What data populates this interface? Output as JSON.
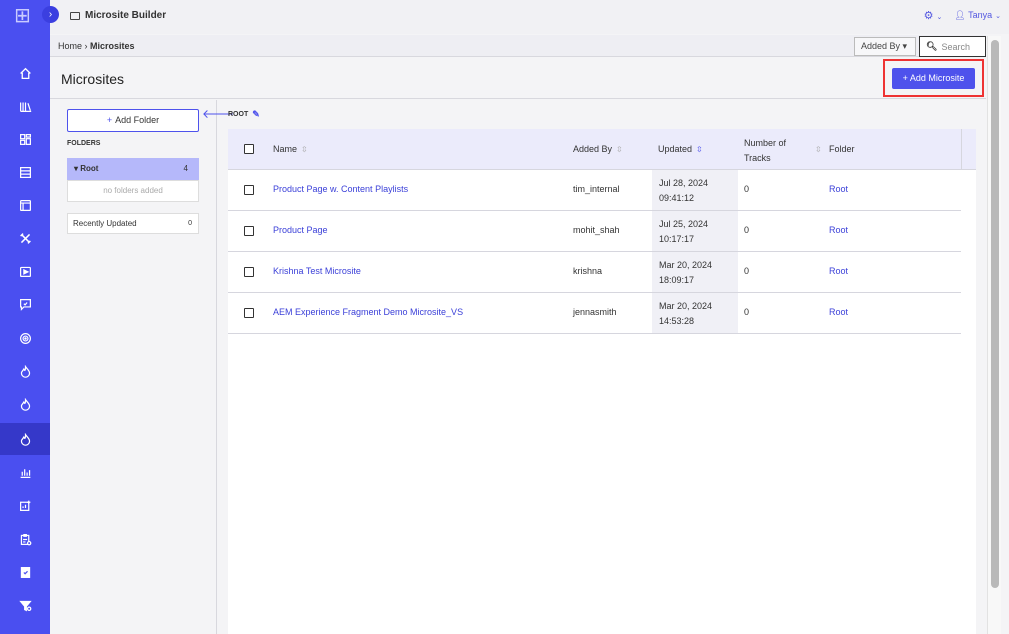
{
  "app": {
    "title": "Microsite Builder"
  },
  "user": {
    "name": "Tanya"
  },
  "breadcrumb": {
    "home": "Home",
    "separator": "›",
    "current": "Microsites"
  },
  "filters": {
    "added_by_label": "Added By",
    "search_placeholder": "Search"
  },
  "page": {
    "title": "Microsites",
    "add_button": "Add Microsite"
  },
  "folders": {
    "add_button": "Add Folder",
    "section_label": "FOLDERS",
    "root": {
      "label": "Root",
      "count": "4"
    },
    "empty_text": "no folders added",
    "recently_updated": {
      "label": "Recently Updated",
      "count": "0"
    }
  },
  "main": {
    "root_label": "ROOT"
  },
  "table": {
    "columns": {
      "name": "Name",
      "added_by": "Added By",
      "updated": "Updated",
      "tracks_line1": "Number of",
      "tracks_line2": "Tracks",
      "folder": "Folder"
    },
    "rows": [
      {
        "name": "Product Page w. Content Playlists",
        "added_by": "tim_internal",
        "date": "Jul 28, 2024",
        "time": "09:41:12",
        "tracks": "0",
        "folder": "Root"
      },
      {
        "name": "Product Page",
        "added_by": "mohit_shah",
        "date": "Jul 25, 2024",
        "time": "10:17:17",
        "tracks": "0",
        "folder": "Root"
      },
      {
        "name": "Krishna Test Microsite",
        "added_by": "krishna",
        "date": "Mar 20, 2024",
        "time": "18:09:17",
        "tracks": "0",
        "folder": "Root"
      },
      {
        "name": "AEM Experience Fragment Demo Microsite_VS",
        "added_by": "jennasmith",
        "date": "Mar 20, 2024",
        "time": "14:53:28",
        "tracks": "0",
        "folder": "Root"
      }
    ]
  },
  "sidebar_icons": [
    "home-icon",
    "library-icon",
    "grid-icon",
    "list-icon",
    "window-icon",
    "tools-icon",
    "video-icon",
    "chat-icon",
    "target-icon",
    "flame-icon",
    "flame-alt-icon",
    "microsite-icon",
    "analytics-icon",
    "reports-icon",
    "clipboard-icon",
    "bookmark-icon",
    "filter-icon"
  ],
  "colors": {
    "brand": "#4a4ff0",
    "accent": "#4e52ec",
    "highlight_box": "#e33333"
  }
}
